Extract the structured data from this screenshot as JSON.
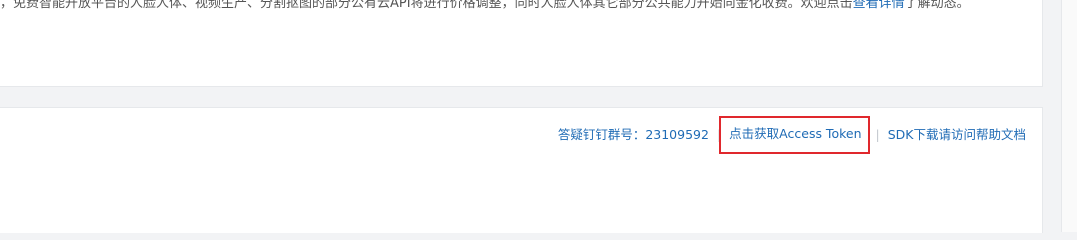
{
  "intro": {
    "text": "，免费智能开放平台的人脸人体、视频生产、分割抠图的部分公有云API将进行价格调整，同时人脸人体其它部分公共能力开始向金化收费。欢迎点击",
    "link_text": "查看详情",
    "tail": "了解动态。"
  },
  "links": {
    "dingtalk_group": "答疑钉钉群号：23109592",
    "access_token": "点击获取Access Token",
    "sdk_help": "SDK下载请访问帮助文档"
  },
  "colors": {
    "link": "#1f6bb5",
    "highlight_border": "#e0282d"
  }
}
